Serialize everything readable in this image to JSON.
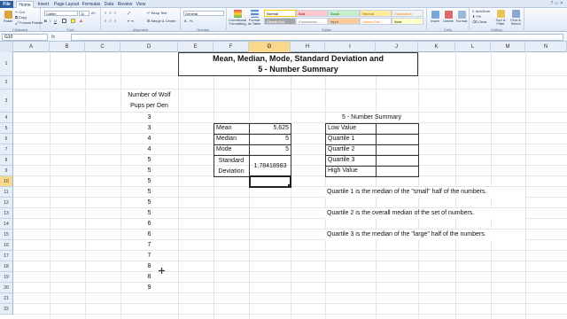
{
  "ribbon": {
    "tabs": [
      "File",
      "Home",
      "Insert",
      "Page Layout",
      "Formulas",
      "Data",
      "Review",
      "View"
    ],
    "clipboard": {
      "cut": "Cut",
      "copy": "Copy",
      "painter": "Format Painter",
      "label": "Clipboard",
      "paste": "Paste"
    },
    "font": {
      "name": "Calibri",
      "size": "11",
      "label": "Font"
    },
    "alignment": {
      "wrap": "Wrap Text",
      "merge": "Merge & Center",
      "label": "Alignment"
    },
    "number": {
      "format": "General",
      "label": "Number",
      "symbols": "$ - % ,"
    },
    "styles": {
      "label": "Styles",
      "cond": "Conditional Formatting",
      "table": "Format as Table",
      "items": [
        "Normal",
        "Bad",
        "Good",
        "Neutral",
        "Calculation",
        "Check Cell",
        "Explanatory ...",
        "Input",
        "Linked Cell",
        "Note"
      ]
    },
    "cells": {
      "insert": "Insert",
      "delete": "Delete",
      "format": "Format",
      "label": "Cells"
    },
    "editing": {
      "autosum": "AutoSum",
      "fill": "Fill",
      "clear": "Clear",
      "sort": "Sort & Filter",
      "find": "Find & Select",
      "label": "Editing"
    }
  },
  "formula_bar": {
    "name_box": "G10",
    "fx": "fx",
    "value": ""
  },
  "columns": [
    "A",
    "B",
    "C",
    "D",
    "E",
    "F",
    "G",
    "H",
    "I",
    "J",
    "K",
    "L",
    "M",
    "N"
  ],
  "rows": [
    "1",
    "2",
    "3",
    "4",
    "5",
    "6",
    "7",
    "8",
    "9",
    "10",
    "11",
    "12",
    "13",
    "14",
    "15",
    "16",
    "17",
    "18",
    "19",
    "20",
    "21",
    "22"
  ],
  "selected": {
    "column": "G",
    "row": "10"
  },
  "sheet": {
    "title_line1": "Mean, Median, Mode, Standard Deviation and",
    "title_line2": "5 - Number Summary",
    "data_header_line1": "Number of Wolf",
    "data_header_line2": "Pups per Den",
    "values": [
      "3",
      "3",
      "4",
      "4",
      "5",
      "5",
      "5",
      "5",
      "5",
      "5",
      "6",
      "6",
      "7",
      "7",
      "8",
      "8",
      "9"
    ],
    "stats": {
      "mean_label": "Mean",
      "mean_value": "5.625",
      "median_label": "Median",
      "median_value": "5",
      "mode_label": "Mode",
      "mode_value": "5",
      "sd_label_1": "Standard",
      "sd_label_2": "Deviation",
      "sd_value": "1.78418983"
    },
    "summary": {
      "header": "5 - Number Summary",
      "items": [
        "Low Value",
        "Quartile 1",
        "Quartile 2",
        "Quartile 3",
        "High Value"
      ]
    },
    "notes": [
      "Quartile 1 is the median of the \"small\" half of the numbers.",
      "Quartile 2 is the overall median of the set of numbers.",
      "Quartile 3 is the median of the \"large\" half of the numbers."
    ]
  }
}
